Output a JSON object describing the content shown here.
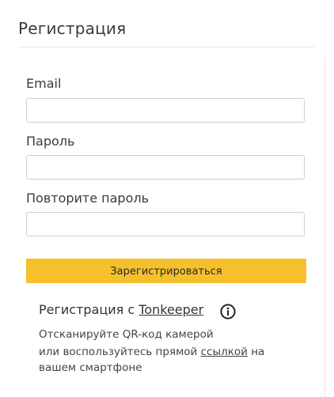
{
  "header": {
    "title": "Регистрация"
  },
  "form": {
    "email_label": "Email",
    "email_value": "",
    "password_label": "Пароль",
    "password_value": "",
    "repeat_label": "Повторите пароль",
    "repeat_value": "",
    "submit_label": "Зарегистрироваться"
  },
  "tonkeeper": {
    "heading_prefix": "Регистрация с ",
    "heading_link": "Tonkeeper",
    "info_icon": "info-circle-icon",
    "line1": "Отсканируйте QR-код камерой",
    "line2_prefix": "или воспользуйтесь прямой ",
    "line2_link": "ссылкой",
    "line2_suffix": " на",
    "line3": "вашем смартфоне"
  },
  "colors": {
    "accent": "#f5c02c",
    "border": "#cfcfcf",
    "text": "#333333"
  }
}
